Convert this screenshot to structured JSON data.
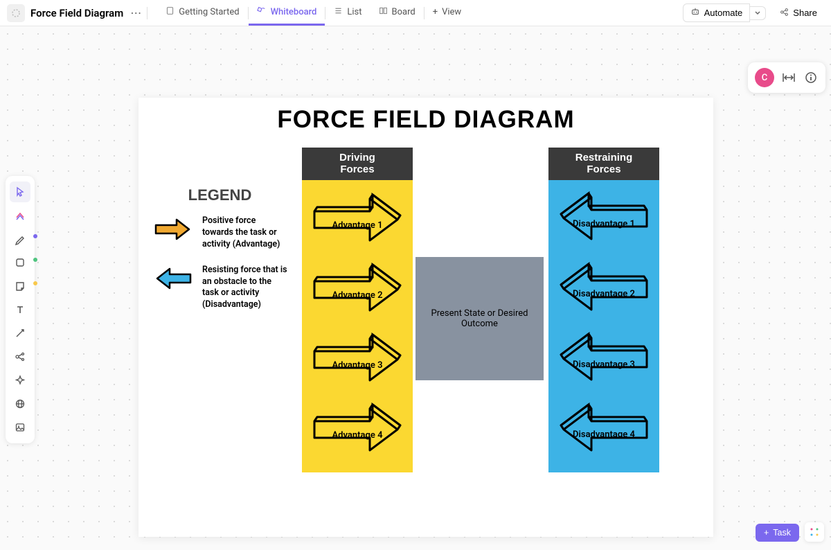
{
  "header": {
    "title": "Force Field Diagram",
    "tabs": {
      "getting_started": "Getting Started",
      "whiteboard": "Whiteboard",
      "list": "List",
      "board": "Board",
      "view": "View"
    },
    "automate": "Automate",
    "share": "Share"
  },
  "canvas": {
    "title": "FORCE FIELD DIAGRAM",
    "driving_header": "Driving\nForces",
    "restraining_header": "Restraining\nForces",
    "center": "Present State or Desired Outcome",
    "advantages": [
      "Advantage 1",
      "Advantage 2",
      "Advantage 3",
      "Advantage 4"
    ],
    "disadvantages": [
      "Disadvantage 1",
      "Disadvantage 2",
      "Disadvantage 3",
      "Disadvantage 4"
    ],
    "legend": {
      "title": "LEGEND",
      "positive": "Positive force towards the task or activity (Advantage)",
      "negative": "Resisting force that is an obstacle to the task or activity (Disadvantage)"
    }
  },
  "user": {
    "initial": "C"
  },
  "task_button": "Task"
}
